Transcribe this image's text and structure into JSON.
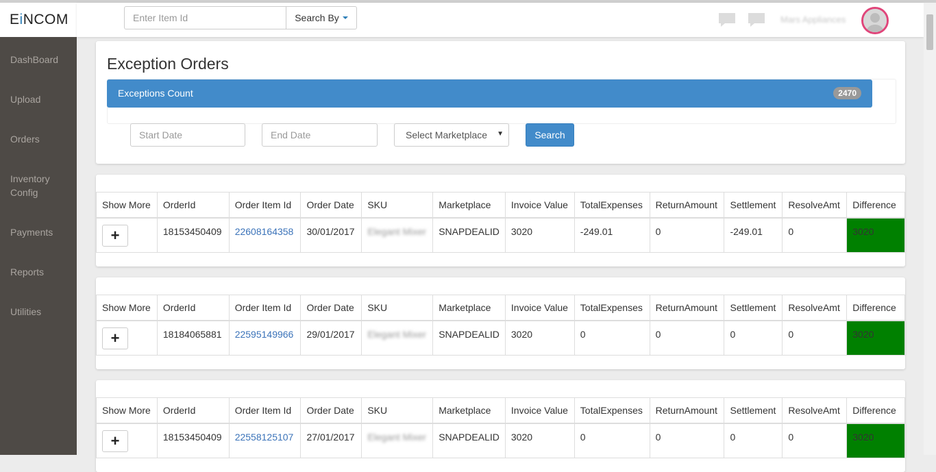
{
  "brand": {
    "name_start": "E",
    "name_accent": "i",
    "name_end": "NCOM"
  },
  "header": {
    "search_placeholder": "Enter Item Id",
    "search_by_label": "Search By",
    "user_name": "Mars Appliances"
  },
  "sidebar": {
    "items": [
      {
        "label": "DashBoard"
      },
      {
        "label": "Upload"
      },
      {
        "label": "Orders"
      },
      {
        "label": "Inventory Config"
      },
      {
        "label": "Payments"
      },
      {
        "label": "Reports"
      },
      {
        "label": "Utilities"
      }
    ]
  },
  "page": {
    "title": "Exception Orders",
    "count_label": "Exceptions Count",
    "count_value": "2470",
    "start_date_placeholder": "Start Date",
    "end_date_placeholder": "End Date",
    "marketplace_select": "Select Marketplace",
    "search_button": "Search"
  },
  "table_headers": [
    "Show More",
    "OrderId",
    "Order Item Id",
    "Order Date",
    "SKU",
    "Marketplace",
    "Invoice Value",
    "TotalExpenses",
    "ReturnAmount",
    "Settlement",
    "ResolveAmt",
    "Difference"
  ],
  "orders": [
    {
      "plus": "+",
      "order_id": "18153450409",
      "order_item_id": "22608164358",
      "order_date": "30/01/2017",
      "sku": "Elegant Mixer",
      "marketplace": "SNAPDEALID",
      "invoice_value": "3020",
      "total_expenses": "-249.01",
      "return_amount": "0",
      "settlement": "-249.01",
      "resolve_amt": "0",
      "difference": "3020"
    },
    {
      "plus": "+",
      "order_id": "18184065881",
      "order_item_id": "22595149966",
      "order_date": "29/01/2017",
      "sku": "Elegant Mixer",
      "marketplace": "SNAPDEALID",
      "invoice_value": "3020",
      "total_expenses": "0",
      "return_amount": "0",
      "settlement": "0",
      "resolve_amt": "0",
      "difference": "3020"
    },
    {
      "plus": "+",
      "order_id": "18153450409",
      "order_item_id": "22558125107",
      "order_date": "27/01/2017",
      "sku": "Elegant Mixer",
      "marketplace": "SNAPDEALID",
      "invoice_value": "3020",
      "total_expenses": "0",
      "return_amount": "0",
      "settlement": "0",
      "resolve_amt": "0",
      "difference": "3020"
    }
  ],
  "colors": {
    "primary": "#428bca",
    "sidebar": "#4e4a46",
    "difference_ok": "#008000",
    "avatar_ring": "#e0457a"
  },
  "icons": [
    "chat-bubble-icon",
    "comment-icon",
    "user-avatar-icon",
    "plus-icon",
    "caret-down-icon"
  ]
}
